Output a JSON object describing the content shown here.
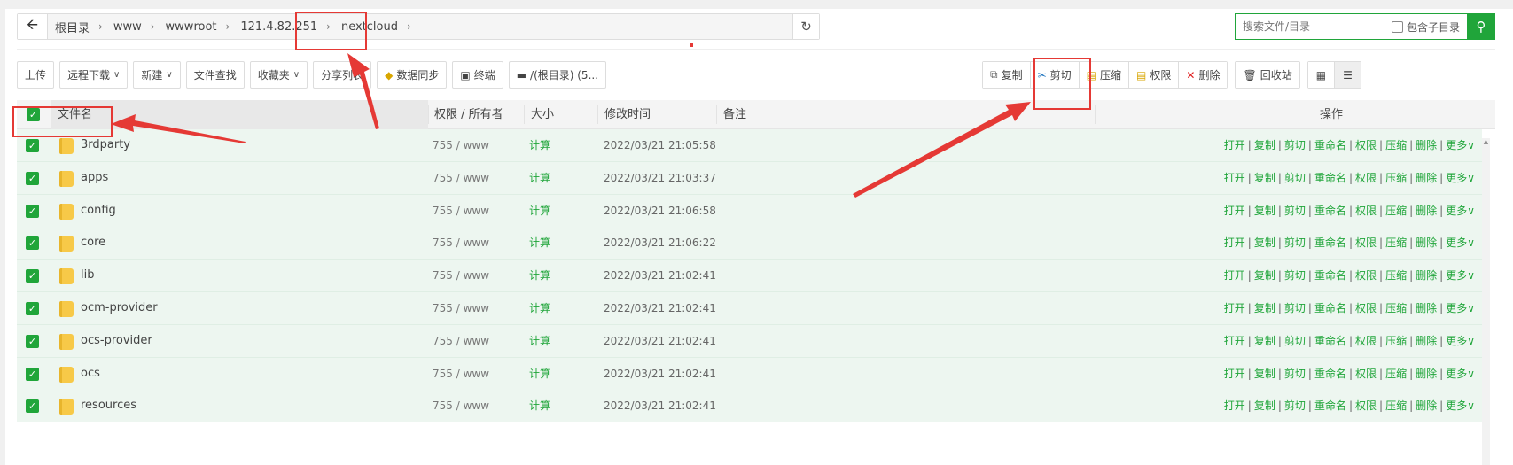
{
  "breadcrumb": {
    "back_icon": "arrow-left-icon",
    "items": [
      "根目录",
      "www",
      "wwwroot",
      "121.4.82.251",
      "nextcloud"
    ],
    "refresh_icon": "refresh-icon"
  },
  "search": {
    "placeholder": "搜索文件/目录",
    "include_subdir_label": "包含子目录",
    "include_subdir_checked": false,
    "button_icon": "search-icon"
  },
  "toolbar": {
    "left": [
      {
        "label": "上传",
        "dropdown": false
      },
      {
        "label": "远程下载",
        "dropdown": true
      },
      {
        "label": "新建",
        "dropdown": true
      },
      {
        "label": "文件查找",
        "dropdown": false
      },
      {
        "label": "收藏夹",
        "dropdown": true
      },
      {
        "label": "分享列表",
        "dropdown": false
      },
      {
        "label": "数据同步",
        "icon": "diamond-icon"
      },
      {
        "label": "终端",
        "icon": "terminal-icon"
      },
      {
        "label": "/(根目录) (5...",
        "icon": "disk-icon"
      }
    ],
    "batch": [
      {
        "label": "复制",
        "icon": "copy-icon"
      },
      {
        "label": "剪切",
        "icon": "scissors-icon"
      },
      {
        "label": "压缩",
        "icon": "zip-icon"
      },
      {
        "label": "权限",
        "icon": "permission-icon"
      },
      {
        "label": "删除",
        "icon": "delete-icon"
      }
    ],
    "recycle": {
      "label": "回收站",
      "icon": "trash-icon"
    },
    "view_icons": [
      "grid-view-icon",
      "list-view-icon"
    ]
  },
  "table": {
    "headers": {
      "name": "文件名",
      "perm": "权限 / 所有者",
      "size": "大小",
      "mtime": "修改时间",
      "note": "备注",
      "ops": "操作"
    },
    "select_all_checked": true,
    "rows": [
      {
        "name": "3rdparty",
        "perm": "755 / www",
        "size": "计算",
        "mtime": "2022/03/21 21:05:58"
      },
      {
        "name": "apps",
        "perm": "755 / www",
        "size": "计算",
        "mtime": "2022/03/21 21:03:37"
      },
      {
        "name": "config",
        "perm": "755 / www",
        "size": "计算",
        "mtime": "2022/03/21 21:06:58"
      },
      {
        "name": "core",
        "perm": "755 / www",
        "size": "计算",
        "mtime": "2022/03/21 21:06:22"
      },
      {
        "name": "lib",
        "perm": "755 / www",
        "size": "计算",
        "mtime": "2022/03/21 21:02:41"
      },
      {
        "name": "ocm-provider",
        "perm": "755 / www",
        "size": "计算",
        "mtime": "2022/03/21 21:02:41"
      },
      {
        "name": "ocs-provider",
        "perm": "755 / www",
        "size": "计算",
        "mtime": "2022/03/21 21:02:41"
      },
      {
        "name": "ocs",
        "perm": "755 / www",
        "size": "计算",
        "mtime": "2022/03/21 21:02:41"
      },
      {
        "name": "resources",
        "perm": "755 / www",
        "size": "计算",
        "mtime": "2022/03/21 21:02:41"
      }
    ],
    "row_ops": [
      "打开",
      "复制",
      "剪切",
      "重命名",
      "权限",
      "压缩",
      "删除",
      "更多"
    ]
  },
  "colors": {
    "accent": "#20a53a",
    "annotation": "#e53935",
    "row_bg": "#edf6f0"
  }
}
